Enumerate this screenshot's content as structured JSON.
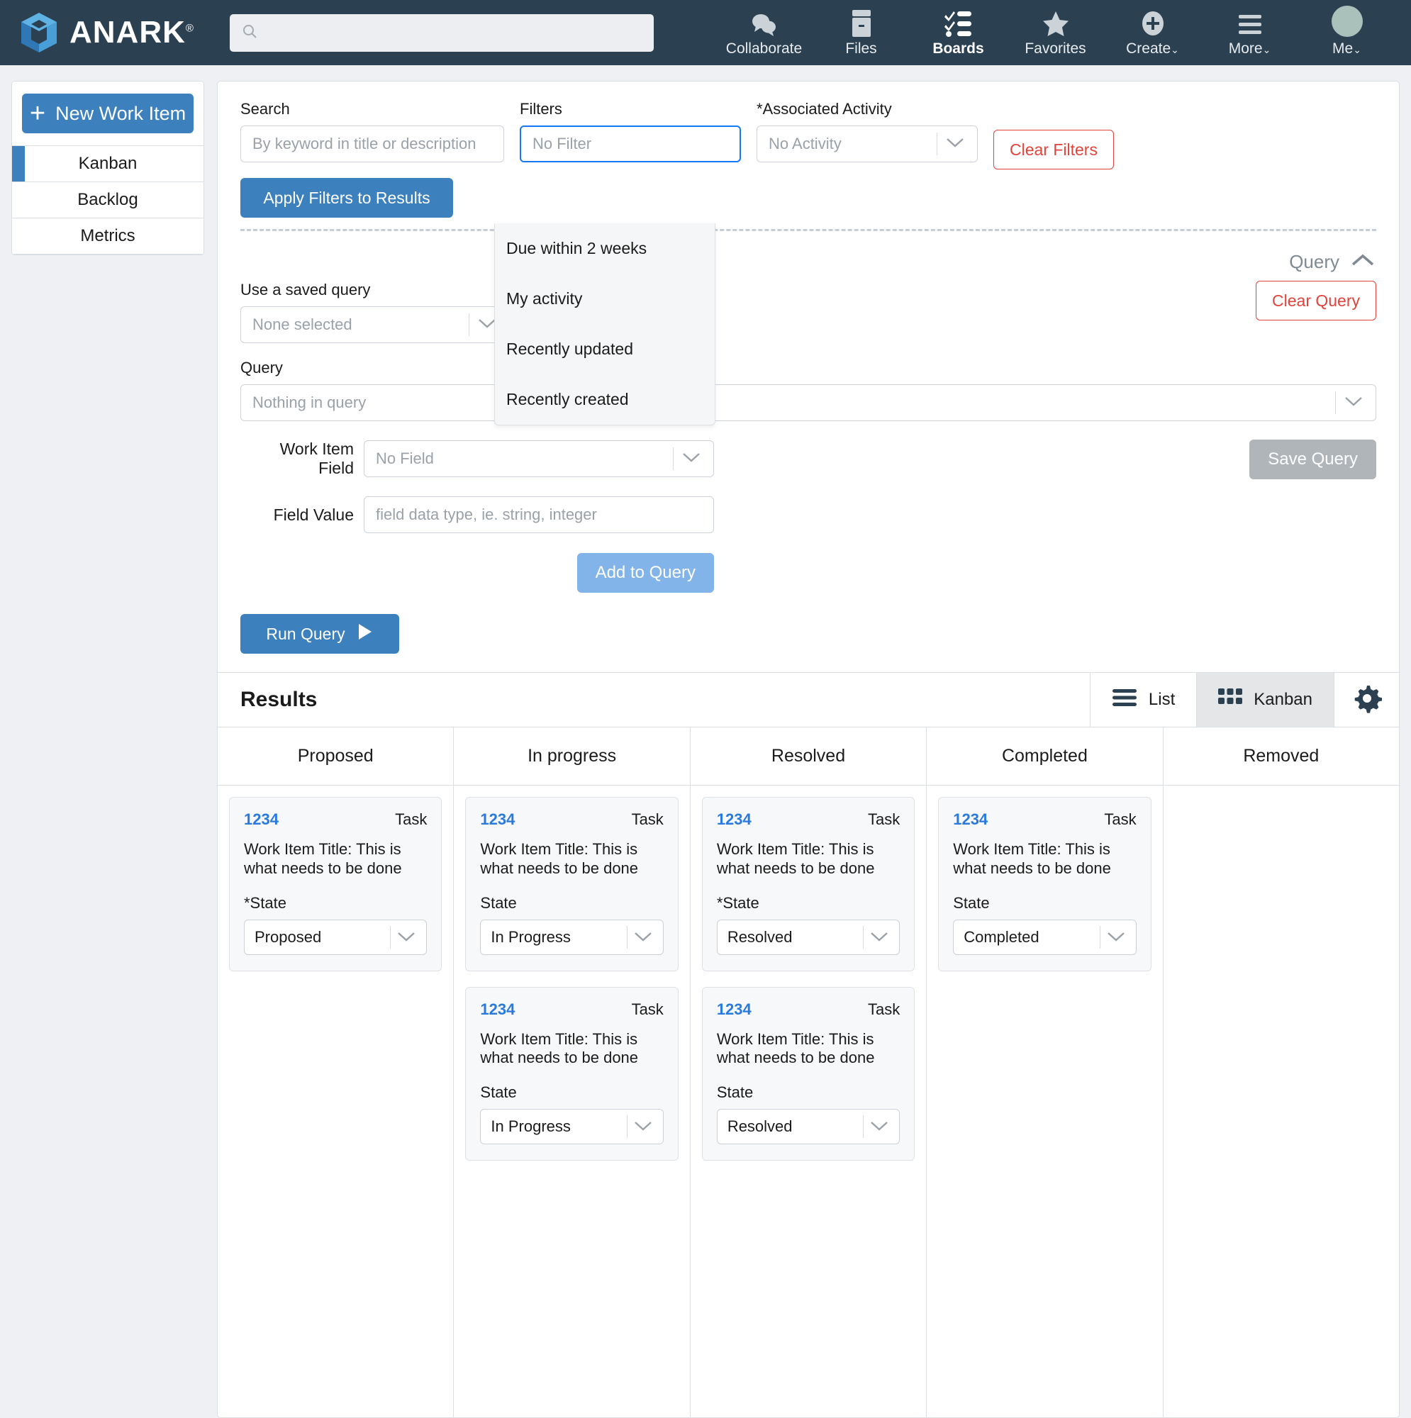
{
  "brand": {
    "name": "ANARK",
    "reg": "®"
  },
  "topnav": {
    "search_placeholder": "",
    "search_value": "",
    "items": [
      {
        "label": "Collaborate",
        "icon": "chat-bubbles-icon",
        "caret": "",
        "active": false
      },
      {
        "label": "Files",
        "icon": "file-cabinet-icon",
        "caret": "",
        "active": false
      },
      {
        "label": "Boards",
        "icon": "checklist-icon",
        "caret": "",
        "active": true
      },
      {
        "label": "Favorites",
        "icon": "star-icon",
        "caret": "",
        "active": false
      },
      {
        "label": "Create",
        "icon": "plus-circle-icon",
        "caret": "⌄",
        "active": false
      },
      {
        "label": "More",
        "icon": "hamburger-icon",
        "caret": "⌄",
        "active": false
      },
      {
        "label": "Me",
        "icon": "avatar-icon",
        "caret": "⌄",
        "active": false
      }
    ]
  },
  "sidebar": {
    "new_item_label": "New Work Item",
    "new_item_plus": "+",
    "items": [
      {
        "label": "Kanban",
        "active": true
      },
      {
        "label": "Backlog",
        "active": false
      },
      {
        "label": "Metrics",
        "active": false
      }
    ]
  },
  "filters": {
    "search_label": "Search",
    "search_placeholder": "By keyword in title or description",
    "search_value": "",
    "apply_label": "Apply Filters to Results",
    "filters_label": "Filters",
    "filters_value": "No Filter",
    "filters_options": [
      "Due within 2 weeks",
      "My activity",
      "Recently updated",
      "Recently created"
    ],
    "activity_label": "*Associated Activity",
    "activity_value": "No Activity",
    "clear_filters_label": "Clear Filters"
  },
  "query": {
    "section_label": "Query",
    "collapse_icon": "chevron-up-icon",
    "clear_query_label": "Clear Query",
    "saved_query_label": "Use a saved query",
    "saved_query_value": "None selected",
    "query_label": "Query",
    "query_placeholder": "Nothing in query",
    "work_item_field_label": "Work Item Field",
    "work_item_field_value": "No Field",
    "field_value_label": "Field Value",
    "field_value_placeholder": "field data type, ie. string, integer",
    "save_query_label": "Save Query",
    "add_to_query_label": "Add to Query",
    "run_query_label": "Run Query",
    "run_query_icon": "play-icon"
  },
  "results": {
    "title": "Results",
    "views": [
      {
        "label": "List",
        "icon": "list-view-icon",
        "active": false
      },
      {
        "label": "Kanban",
        "icon": "grid-view-icon",
        "active": true
      }
    ],
    "settings_icon": "gear-icon",
    "columns": [
      {
        "name": "Proposed",
        "cards": [
          {
            "id": "1234",
            "type": "Task",
            "title": "Work Item Title: This is what needs to be done",
            "state_label": "*State",
            "state_value": "Proposed"
          }
        ]
      },
      {
        "name": "In progress",
        "cards": [
          {
            "id": "1234",
            "type": "Task",
            "title": "Work Item Title: This is what needs to be done",
            "state_label": "State",
            "state_value": "In Progress"
          },
          {
            "id": "1234",
            "type": "Task",
            "title": "Work Item Title: This is what needs to be done",
            "state_label": "State",
            "state_value": "In Progress"
          }
        ]
      },
      {
        "name": "Resolved",
        "cards": [
          {
            "id": "1234",
            "type": "Task",
            "title": "Work Item Title: This is what needs to be done",
            "state_label": "*State",
            "state_value": "Resolved"
          },
          {
            "id": "1234",
            "type": "Task",
            "title": "Work Item Title: This is what needs to be done",
            "state_label": "State",
            "state_value": "Resolved"
          }
        ]
      },
      {
        "name": "Completed",
        "cards": [
          {
            "id": "1234",
            "type": "Task",
            "title": "Work Item Title: This is what needs to be done",
            "state_label": "State",
            "state_value": "Completed"
          }
        ]
      },
      {
        "name": "Removed",
        "cards": []
      }
    ]
  },
  "colors": {
    "nav_bg": "#2b4050",
    "accent_blue": "#3c81bd",
    "link_blue": "#2a7ade",
    "danger_red": "#e2433b",
    "focus_blue": "#1877f2"
  }
}
